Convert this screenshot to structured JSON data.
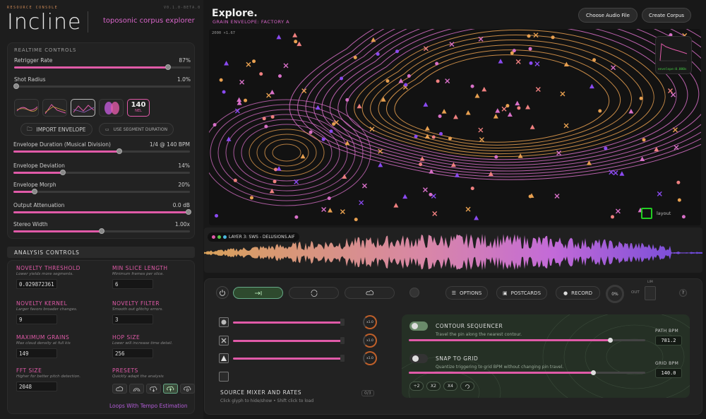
{
  "app": {
    "brand_tag": "RESOURCE CONSOLE",
    "version": "V0.1.0-BETA.0",
    "title": "Incline",
    "subtitle": "toposonic corpus explorer"
  },
  "realtime": {
    "title": "REALTIME CONTROLS",
    "sliders_top": [
      {
        "label": "Retrigger Rate",
        "value": "87%",
        "fraction": 0.87
      },
      {
        "label": "Shot Radius",
        "value": "1.0%",
        "fraction": 0.01
      }
    ],
    "envelope_nel": {
      "value": "140",
      "unit": "NEL"
    },
    "import_label": "IMPORT ENVELOPE",
    "segment_label": "USE SEGMENT DURATION",
    "sliders": [
      {
        "label": "Envelope Duration (Musical Division)",
        "value": "1/4 @ 140 BPM",
        "fraction": 0.6
      },
      {
        "label": "Envelope Deviation",
        "value": "14%",
        "fraction": 0.28
      },
      {
        "label": "Envelope Morph",
        "value": "20%",
        "fraction": 0.12
      },
      {
        "label": "Output Attenuation",
        "value": "0.0 dB",
        "fraction": 1.0
      },
      {
        "label": "Stereo Width",
        "value": "1.00x",
        "fraction": 0.5
      }
    ]
  },
  "analysis": {
    "title": "ANALYSIS CONTROLS",
    "items": [
      {
        "label": "NOVELTY THRESHOLD",
        "desc": "Lower yields more segments.",
        "value": "0.029872361"
      },
      {
        "label": "MIN SLICE LENGTH",
        "desc": "Minimum frames per slice.",
        "value": "6"
      },
      {
        "label": "NOVELTY KERNEL",
        "desc": "Larger favors broader changes.",
        "value": "9"
      },
      {
        "label": "NOVELTY FILTER",
        "desc": "Smooth out glitchy errors.",
        "value": "3"
      },
      {
        "label": "MAXIMUM GRAINS",
        "desc": "Max cloud density at full kis",
        "value": "149"
      },
      {
        "label": "HOP SIZE",
        "desc": "Lower will increase time detail.",
        "value": "256"
      },
      {
        "label": "FFT SIZE",
        "desc": "Higher for better pitch detection.",
        "value": "2048"
      }
    ],
    "presets_label": "PRESETS",
    "presets_desc": "Quickly adapt the analysis",
    "footer": "Loops With Tempo Estimation"
  },
  "header": {
    "title": "Explore.",
    "subtitle": "GRAIN ENVELOPE: FACTORY A",
    "choose_audio": "Choose Audio File",
    "create_corpus": "Create Corpus"
  },
  "map": {
    "zoom_info": "2000  ×1.67",
    "envelope_readout": "envelope:0.000s",
    "layout_label": "layout"
  },
  "waveform": {
    "layer_label": "LAYER 3: SWS - DELUSIONS.AIF",
    "colors": [
      "#e05aa8",
      "#5ac84a",
      "#4ab8e0"
    ]
  },
  "toolbar": {
    "options": "OPTIONS",
    "postcards": "POSTCARDS",
    "record": "RECORD",
    "percent": "0%",
    "out": "OUT",
    "lim": "LIM",
    "help": "?"
  },
  "mixer": {
    "rates": [
      "x1.0",
      "x1.0",
      "x1.0"
    ],
    "title": "SOURCE MIXER AND RATES",
    "help": "Click glyph to hide/show • Shift click to load",
    "count": "0/3"
  },
  "sequencer": {
    "contour_label": "CONTOUR SEQUENCER",
    "contour_desc": "Travel the pin along the nearest contour.",
    "path_bpm_label": "PATH BPM",
    "path_bpm": "781.2",
    "path_fraction": 0.85,
    "snap_label": "SNAP TO GRID",
    "snap_desc": "Quantize triggering to grid BPM without changing pin travel.",
    "grid_bpm_label": "GRID BPM",
    "grid_bpm": "140.0",
    "grid_fraction": 0.78,
    "multipliers": [
      "÷2",
      "X2",
      "X4"
    ]
  }
}
